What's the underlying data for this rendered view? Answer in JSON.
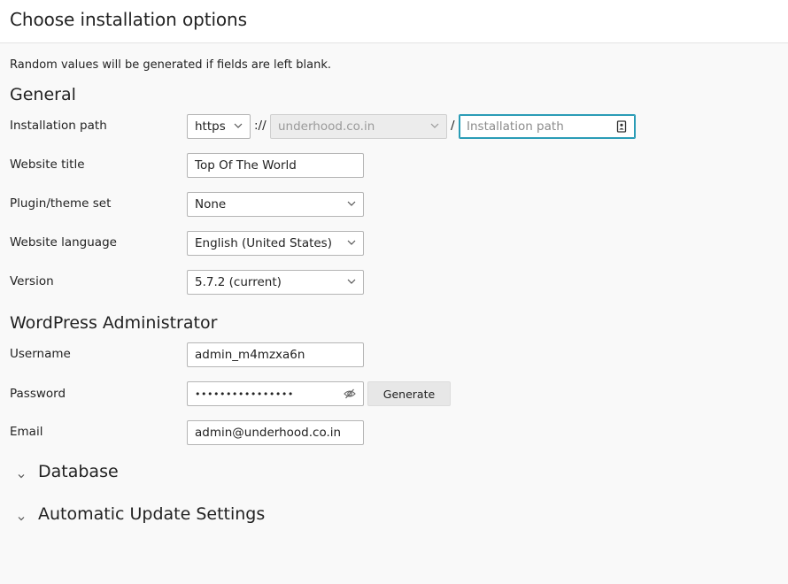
{
  "header": {
    "title": "Choose installation options"
  },
  "note": "Random values will be generated if fields are left blank.",
  "general": {
    "title": "General",
    "installation_path": {
      "label": "Installation path",
      "protocol": "https",
      "separator1": "://",
      "domain": "underhood.co.in",
      "separator2": "/",
      "path_placeholder": "Installation path"
    },
    "website_title": {
      "label": "Website title",
      "value": "Top Of The World"
    },
    "plugin_set": {
      "label": "Plugin/theme set",
      "value": "None"
    },
    "language": {
      "label": "Website language",
      "value": "English (United States)"
    },
    "version": {
      "label": "Version",
      "value": "5.7.2 (current)"
    }
  },
  "admin": {
    "title": "WordPress Administrator",
    "username": {
      "label": "Username",
      "value": "admin_m4mzxa6n"
    },
    "password": {
      "label": "Password",
      "masked": "••••••••••••••••",
      "generate_label": "Generate"
    },
    "email": {
      "label": "Email",
      "value": "admin@underhood.co.in"
    }
  },
  "sections": {
    "database": "Database",
    "auto_updates": "Automatic Update Settings"
  },
  "icons": {
    "chevron": "chevron-down-icon",
    "contact_card": "contact-card-icon",
    "eye_off": "eye-off-icon"
  },
  "colors": {
    "focus": "#2a9cb6",
    "button_bg": "#e7e7e7"
  }
}
